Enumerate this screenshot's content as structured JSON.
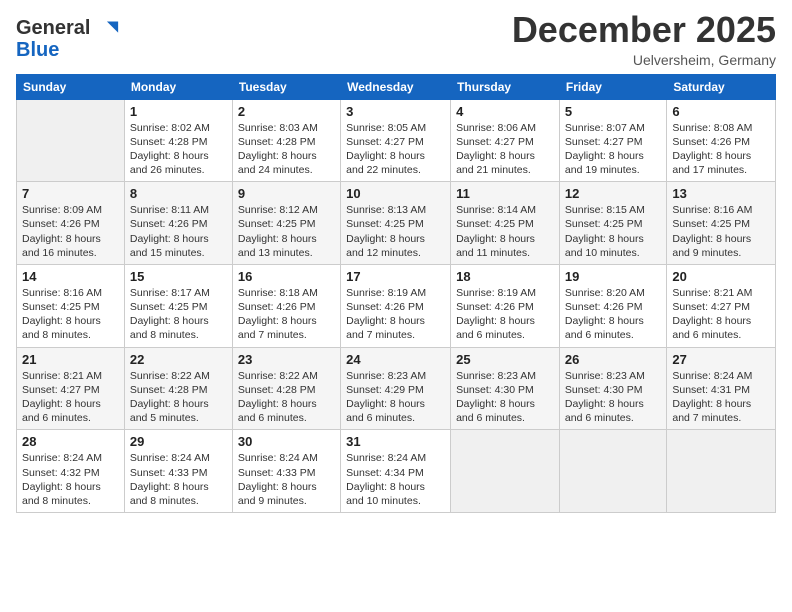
{
  "header": {
    "logo_line1": "General",
    "logo_line2": "Blue",
    "month": "December 2025",
    "location": "Uelversheim, Germany"
  },
  "weekdays": [
    "Sunday",
    "Monday",
    "Tuesday",
    "Wednesday",
    "Thursday",
    "Friday",
    "Saturday"
  ],
  "weeks": [
    [
      {
        "day": "",
        "info": ""
      },
      {
        "day": "1",
        "info": "Sunrise: 8:02 AM\nSunset: 4:28 PM\nDaylight: 8 hours\nand 26 minutes."
      },
      {
        "day": "2",
        "info": "Sunrise: 8:03 AM\nSunset: 4:28 PM\nDaylight: 8 hours\nand 24 minutes."
      },
      {
        "day": "3",
        "info": "Sunrise: 8:05 AM\nSunset: 4:27 PM\nDaylight: 8 hours\nand 22 minutes."
      },
      {
        "day": "4",
        "info": "Sunrise: 8:06 AM\nSunset: 4:27 PM\nDaylight: 8 hours\nand 21 minutes."
      },
      {
        "day": "5",
        "info": "Sunrise: 8:07 AM\nSunset: 4:27 PM\nDaylight: 8 hours\nand 19 minutes."
      },
      {
        "day": "6",
        "info": "Sunrise: 8:08 AM\nSunset: 4:26 PM\nDaylight: 8 hours\nand 17 minutes."
      }
    ],
    [
      {
        "day": "7",
        "info": "Sunrise: 8:09 AM\nSunset: 4:26 PM\nDaylight: 8 hours\nand 16 minutes."
      },
      {
        "day": "8",
        "info": "Sunrise: 8:11 AM\nSunset: 4:26 PM\nDaylight: 8 hours\nand 15 minutes."
      },
      {
        "day": "9",
        "info": "Sunrise: 8:12 AM\nSunset: 4:25 PM\nDaylight: 8 hours\nand 13 minutes."
      },
      {
        "day": "10",
        "info": "Sunrise: 8:13 AM\nSunset: 4:25 PM\nDaylight: 8 hours\nand 12 minutes."
      },
      {
        "day": "11",
        "info": "Sunrise: 8:14 AM\nSunset: 4:25 PM\nDaylight: 8 hours\nand 11 minutes."
      },
      {
        "day": "12",
        "info": "Sunrise: 8:15 AM\nSunset: 4:25 PM\nDaylight: 8 hours\nand 10 minutes."
      },
      {
        "day": "13",
        "info": "Sunrise: 8:16 AM\nSunset: 4:25 PM\nDaylight: 8 hours\nand 9 minutes."
      }
    ],
    [
      {
        "day": "14",
        "info": "Sunrise: 8:16 AM\nSunset: 4:25 PM\nDaylight: 8 hours\nand 8 minutes."
      },
      {
        "day": "15",
        "info": "Sunrise: 8:17 AM\nSunset: 4:25 PM\nDaylight: 8 hours\nand 8 minutes."
      },
      {
        "day": "16",
        "info": "Sunrise: 8:18 AM\nSunset: 4:26 PM\nDaylight: 8 hours\nand 7 minutes."
      },
      {
        "day": "17",
        "info": "Sunrise: 8:19 AM\nSunset: 4:26 PM\nDaylight: 8 hours\nand 7 minutes."
      },
      {
        "day": "18",
        "info": "Sunrise: 8:19 AM\nSunset: 4:26 PM\nDaylight: 8 hours\nand 6 minutes."
      },
      {
        "day": "19",
        "info": "Sunrise: 8:20 AM\nSunset: 4:26 PM\nDaylight: 8 hours\nand 6 minutes."
      },
      {
        "day": "20",
        "info": "Sunrise: 8:21 AM\nSunset: 4:27 PM\nDaylight: 8 hours\nand 6 minutes."
      }
    ],
    [
      {
        "day": "21",
        "info": "Sunrise: 8:21 AM\nSunset: 4:27 PM\nDaylight: 8 hours\nand 6 minutes."
      },
      {
        "day": "22",
        "info": "Sunrise: 8:22 AM\nSunset: 4:28 PM\nDaylight: 8 hours\nand 5 minutes."
      },
      {
        "day": "23",
        "info": "Sunrise: 8:22 AM\nSunset: 4:28 PM\nDaylight: 8 hours\nand 6 minutes."
      },
      {
        "day": "24",
        "info": "Sunrise: 8:23 AM\nSunset: 4:29 PM\nDaylight: 8 hours\nand 6 minutes."
      },
      {
        "day": "25",
        "info": "Sunrise: 8:23 AM\nSunset: 4:30 PM\nDaylight: 8 hours\nand 6 minutes."
      },
      {
        "day": "26",
        "info": "Sunrise: 8:23 AM\nSunset: 4:30 PM\nDaylight: 8 hours\nand 6 minutes."
      },
      {
        "day": "27",
        "info": "Sunrise: 8:24 AM\nSunset: 4:31 PM\nDaylight: 8 hours\nand 7 minutes."
      }
    ],
    [
      {
        "day": "28",
        "info": "Sunrise: 8:24 AM\nSunset: 4:32 PM\nDaylight: 8 hours\nand 8 minutes."
      },
      {
        "day": "29",
        "info": "Sunrise: 8:24 AM\nSunset: 4:33 PM\nDaylight: 8 hours\nand 8 minutes."
      },
      {
        "day": "30",
        "info": "Sunrise: 8:24 AM\nSunset: 4:33 PM\nDaylight: 8 hours\nand 9 minutes."
      },
      {
        "day": "31",
        "info": "Sunrise: 8:24 AM\nSunset: 4:34 PM\nDaylight: 8 hours\nand 10 minutes."
      },
      {
        "day": "",
        "info": ""
      },
      {
        "day": "",
        "info": ""
      },
      {
        "day": "",
        "info": ""
      }
    ]
  ]
}
